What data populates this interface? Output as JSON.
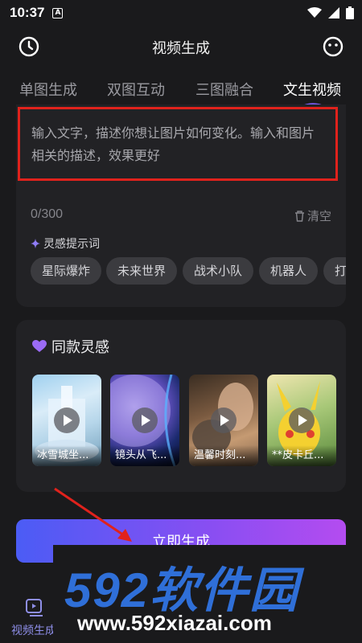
{
  "status_bar": {
    "time": "10:37",
    "a_badge": "A"
  },
  "header": {
    "title": "视频生成",
    "back_icon": "clock-icon",
    "more_icon": "smiley-icon"
  },
  "tabs": [
    {
      "label": "单图生成",
      "active": false
    },
    {
      "label": "双图互动",
      "active": false
    },
    {
      "label": "三图融合",
      "active": false
    },
    {
      "label": "文生视频",
      "active": true
    }
  ],
  "prompt": {
    "placeholder": "输入文字，描述你想让图片如何变化。输入和图片相关的描述，效果更好",
    "counter": "0/300",
    "clear_label": "清空"
  },
  "inspiration": {
    "label": "灵感提示词",
    "chips": [
      "星际爆炸",
      "未来世界",
      "战术小队",
      "机器人",
      "打"
    ]
  },
  "same_style": {
    "title": "同款灵感",
    "items": [
      {
        "caption": "冰雪城坐..."
      },
      {
        "caption": "镜头从飞..."
      },
      {
        "caption": "温馨时刻..."
      },
      {
        "caption": "**皮卡丘..."
      }
    ]
  },
  "generate_button": {
    "label": "立即生成"
  },
  "bottom_nav": {
    "label": "视频生成"
  },
  "watermark": {
    "brand": "592软件园",
    "url": "www.592xiazai.com"
  },
  "colors": {
    "highlight_box": "#e0221c",
    "accent_start": "#4b5cf5",
    "accent_end": "#b44cf0",
    "watermark_blue": "#2f6fd8"
  }
}
